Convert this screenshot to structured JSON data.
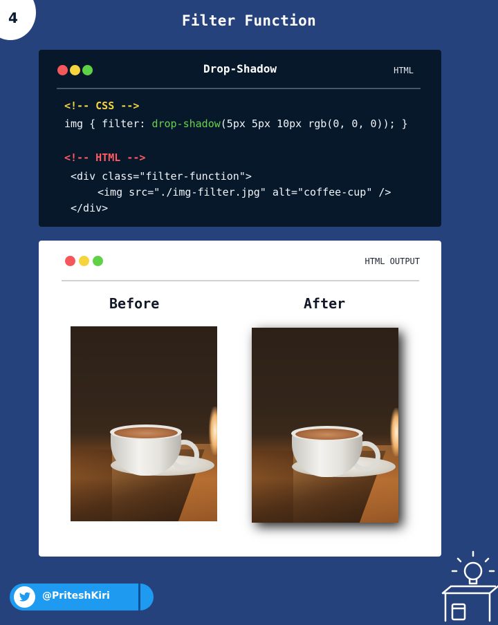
{
  "page": {
    "number": "4",
    "title": "Filter Function"
  },
  "code_card": {
    "title": "Drop-Shadow",
    "language": "HTML",
    "lines": {
      "css_comment": "<!-- CSS -->",
      "css_prefix": "img { filter: ",
      "css_fn": "drop-shadow",
      "css_suffix": "(5px 5px 10px rgb(0, 0, 0)); }",
      "html_comment": "<!-- HTML -->",
      "div_open": "<div class=\"filter-function\">",
      "img_tag": "<img src=\"./img-filter.jpg\" alt=\"coffee-cup\" />",
      "div_close": "</div>"
    }
  },
  "output_card": {
    "label": "HTML OUTPUT",
    "before_label": "Before",
    "after_label": "After"
  },
  "footer": {
    "handle": "@PriteshKiri"
  },
  "colors": {
    "background": "#25427c",
    "code_bg": "#07182b",
    "comment_css": "#f6d43e",
    "comment_html": "#ff5b60",
    "function": "#67d34c",
    "twitter": "#1e9bf0"
  },
  "icons": [
    "twitter-bird-icon",
    "lightbulb-box-logo-icon",
    "window-dots-icon"
  ]
}
